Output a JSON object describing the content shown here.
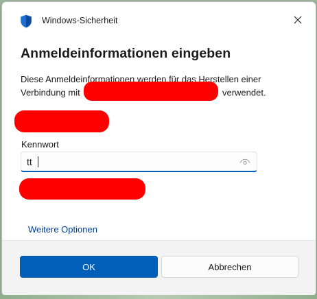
{
  "window": {
    "title": "Windows-Sicherheit",
    "close_icon": "close-icon",
    "app_icon": "shield-icon"
  },
  "dialog": {
    "heading": "Anmeldeinformationen eingeben",
    "description_before": "Diese Anmeldeinformationen werden für das Herstellen einer Verbindung mit",
    "description_after": "verwendet."
  },
  "password": {
    "label": "Kennwort",
    "value": "tt",
    "reveal_icon": "eye-icon"
  },
  "links": {
    "more_options": "Weitere Optionen"
  },
  "buttons": {
    "ok": "OK",
    "cancel": "Abbrechen"
  },
  "colors": {
    "accent": "#005fb8",
    "link": "#003e92",
    "redaction": "#ff0000"
  }
}
